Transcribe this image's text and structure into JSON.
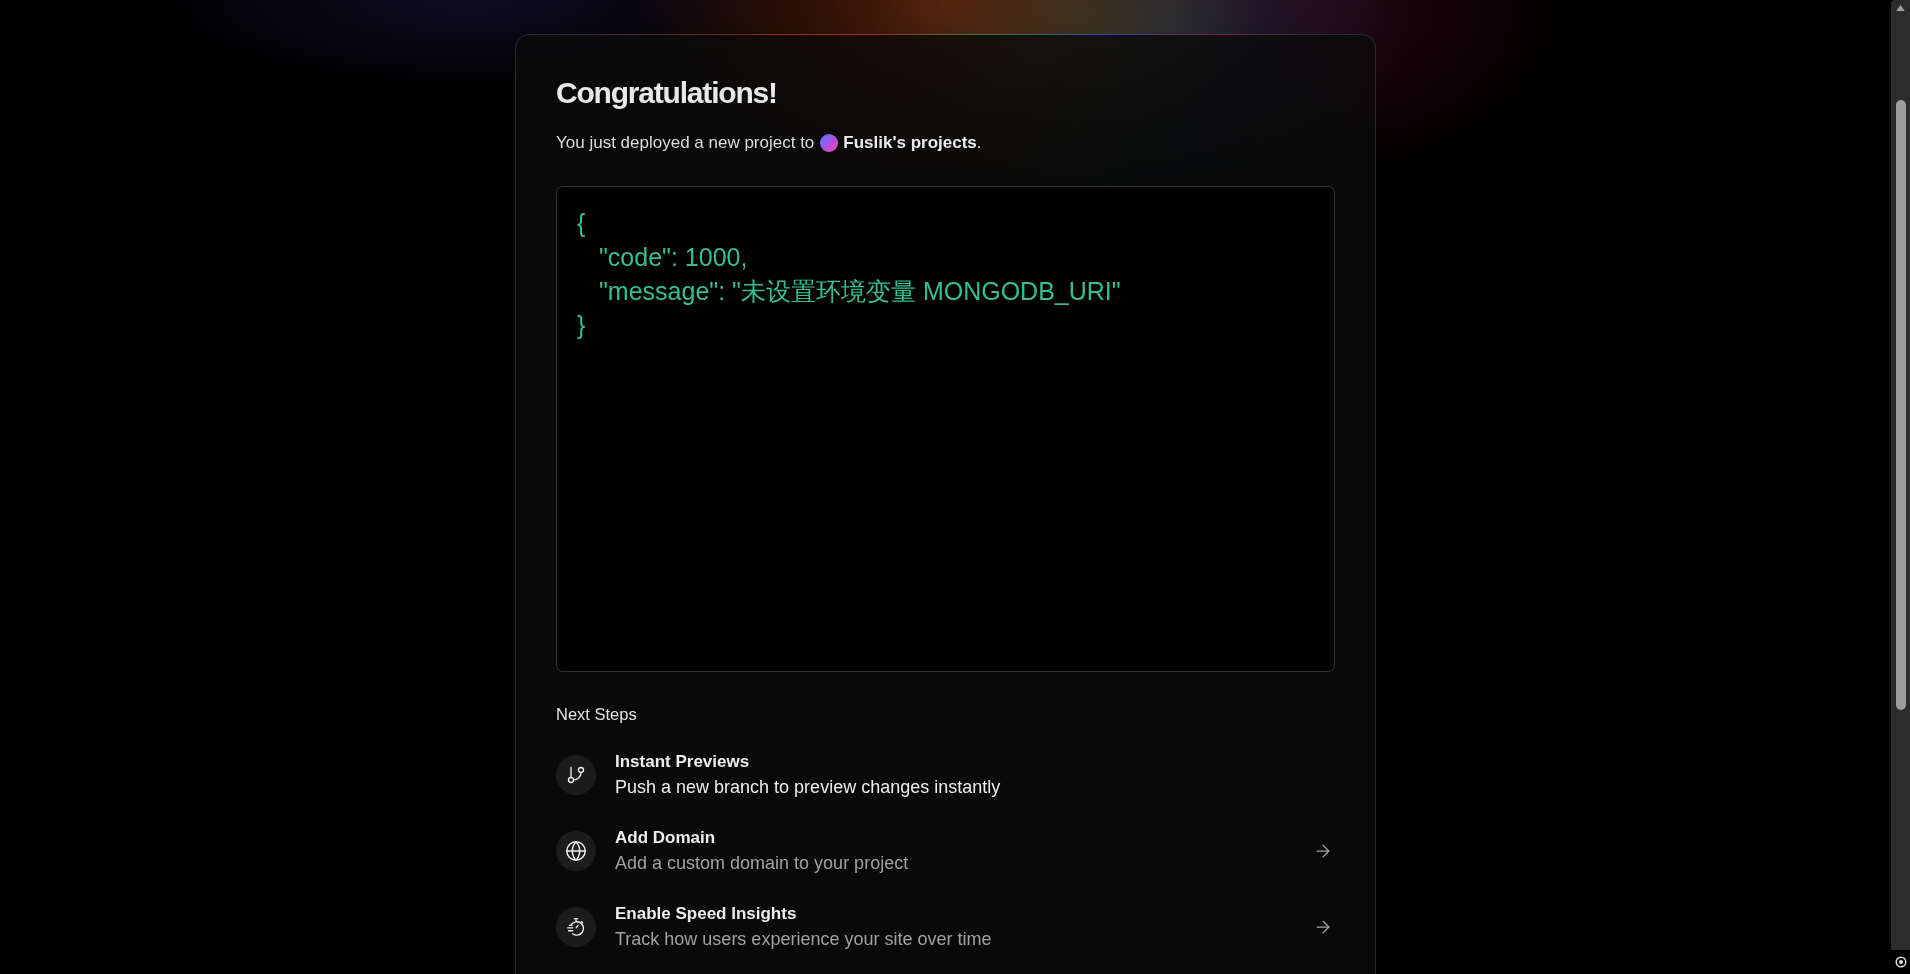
{
  "hero": {
    "title": "Congratulations!",
    "message": "You just deployed a new project to",
    "team": "**Fuslik's projects**."
  },
  "response": {
    "open": "{",
    "entries": [
      "\"code\": 1000,",
      "\"message\": \"未设置环境变量 MONGODB_URI\""
    ],
    "close": "}"
  },
  "next_steps": {
    "heading": "Next Steps",
    "items": [
      {
        "kind": "branch",
        "title": "Instant Previews",
        "description": "Push a new branch to preview changes instantly",
        "highlighted": true,
        "arrow": false
      },
      {
        "kind": "domain",
        "title": "Add Domain",
        "description": "Add a custom domain to your project",
        "highlighted": false,
        "arrow": true
      },
      {
        "kind": "speed",
        "title": "Enable Speed Insights",
        "description": "Track how users experience your site over time",
        "highlighted": false,
        "arrow": true
      }
    ]
  }
}
